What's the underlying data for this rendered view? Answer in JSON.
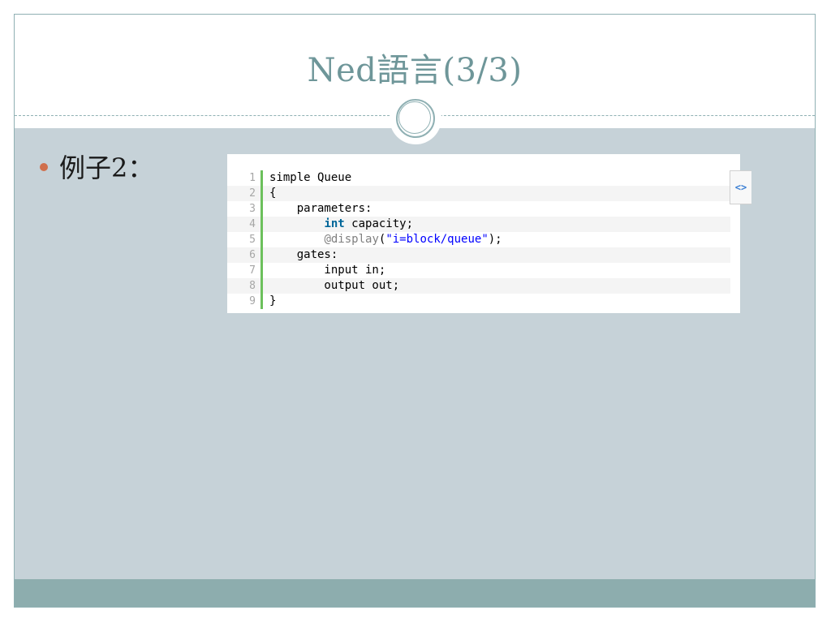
{
  "slide": {
    "title": "Ned語言(3/3)",
    "bullet_text": "例子2："
  },
  "code": {
    "icon": "view-source-icon",
    "lines": [
      {
        "n": "1",
        "text": "simple Queue"
      },
      {
        "n": "2",
        "text": "{"
      },
      {
        "n": "3",
        "text": "    parameters:"
      },
      {
        "n": "4",
        "kw": "int",
        "rest": " capacity;",
        "indent": "        "
      },
      {
        "n": "5",
        "dec": "@display",
        "p1": "(",
        "str": "\"i=block/queue\"",
        "p2": ");",
        "indent": "        "
      },
      {
        "n": "6",
        "text": "    gates:"
      },
      {
        "n": "7",
        "text": "        input in;"
      },
      {
        "n": "8",
        "text": "        output out;"
      },
      {
        "n": "9",
        "text": "}"
      }
    ]
  },
  "colors": {
    "title": "#6e9699",
    "content_bg": "#c6d2d8",
    "footer_bg": "#8dadae",
    "bullet": "#d06f4c",
    "gutter_bar": "#6cc05c"
  }
}
